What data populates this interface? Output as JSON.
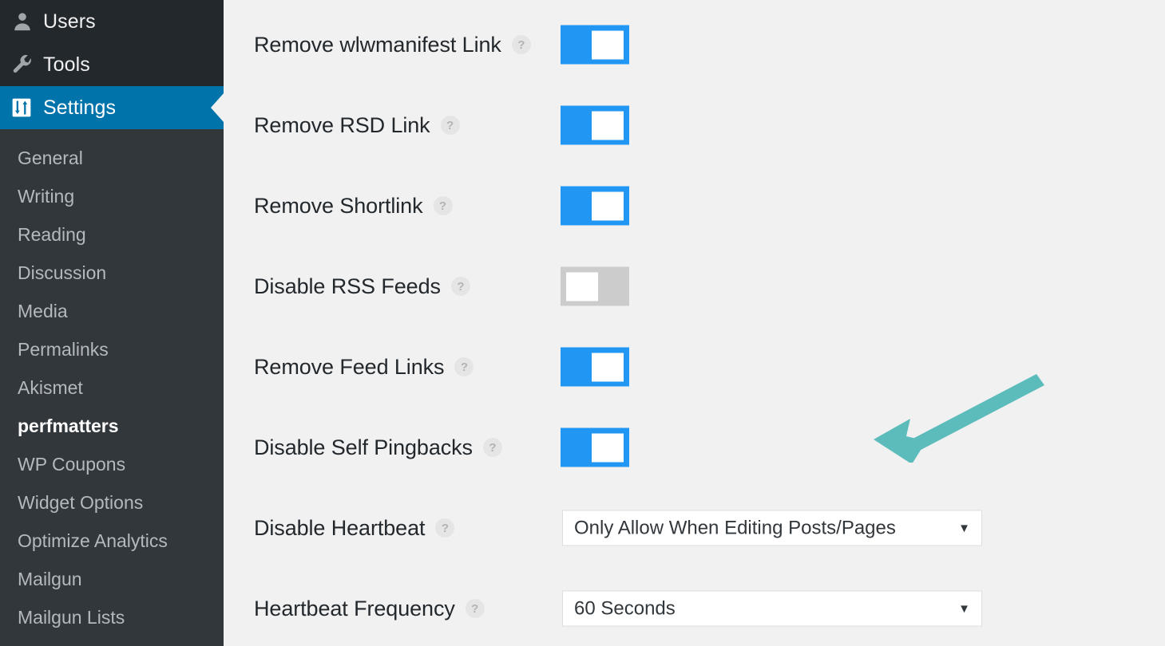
{
  "colors": {
    "sidebar_top_bg": "#23282d",
    "sidebar_submenu_bg": "#32373c",
    "current_menu_bg": "#0073aa",
    "content_bg": "#f1f1f1",
    "toggle_on": "#2196f3",
    "toggle_off": "#cccccc",
    "annotation_arrow": "#5cbcbb",
    "label_text": "#23282d"
  },
  "sidebar": {
    "top_items": [
      {
        "label": "Users",
        "icon": "user-icon",
        "current": false
      },
      {
        "label": "Tools",
        "icon": "wrench-icon",
        "current": false
      },
      {
        "label": "Settings",
        "icon": "settings-sliders-icon",
        "current": true
      }
    ],
    "submenu": [
      {
        "label": "General",
        "active": false
      },
      {
        "label": "Writing",
        "active": false
      },
      {
        "label": "Reading",
        "active": false
      },
      {
        "label": "Discussion",
        "active": false
      },
      {
        "label": "Media",
        "active": false
      },
      {
        "label": "Permalinks",
        "active": false
      },
      {
        "label": "Akismet",
        "active": false
      },
      {
        "label": "perfmatters",
        "active": true
      },
      {
        "label": "WP Coupons",
        "active": false
      },
      {
        "label": "Widget Options",
        "active": false
      },
      {
        "label": "Optimize Analytics",
        "active": false
      },
      {
        "label": "Mailgun",
        "active": false
      },
      {
        "label": "Mailgun Lists",
        "active": false
      }
    ]
  },
  "settings_rows": [
    {
      "label": "Remove wlwmanifest Link",
      "help": "?",
      "control": "toggle",
      "state": "on"
    },
    {
      "label": "Remove RSD Link",
      "help": "?",
      "control": "toggle",
      "state": "on"
    },
    {
      "label": "Remove Shortlink",
      "help": "?",
      "control": "toggle",
      "state": "on"
    },
    {
      "label": "Disable RSS Feeds",
      "help": "?",
      "control": "toggle",
      "state": "off"
    },
    {
      "label": "Remove Feed Links",
      "help": "?",
      "control": "toggle",
      "state": "on"
    },
    {
      "label": "Disable Self Pingbacks",
      "help": "?",
      "control": "toggle",
      "state": "on"
    },
    {
      "label": "Disable Heartbeat",
      "help": "?",
      "control": "select",
      "value": "Only Allow When Editing Posts/Pages",
      "caret": "▼"
    },
    {
      "label": "Heartbeat Frequency",
      "help": "?",
      "control": "select",
      "value": "60 Seconds",
      "caret": "▼"
    }
  ],
  "annotation": {
    "type": "arrow",
    "points_to": "Disable Self Pingbacks toggle",
    "color": "#5cbcbb"
  }
}
